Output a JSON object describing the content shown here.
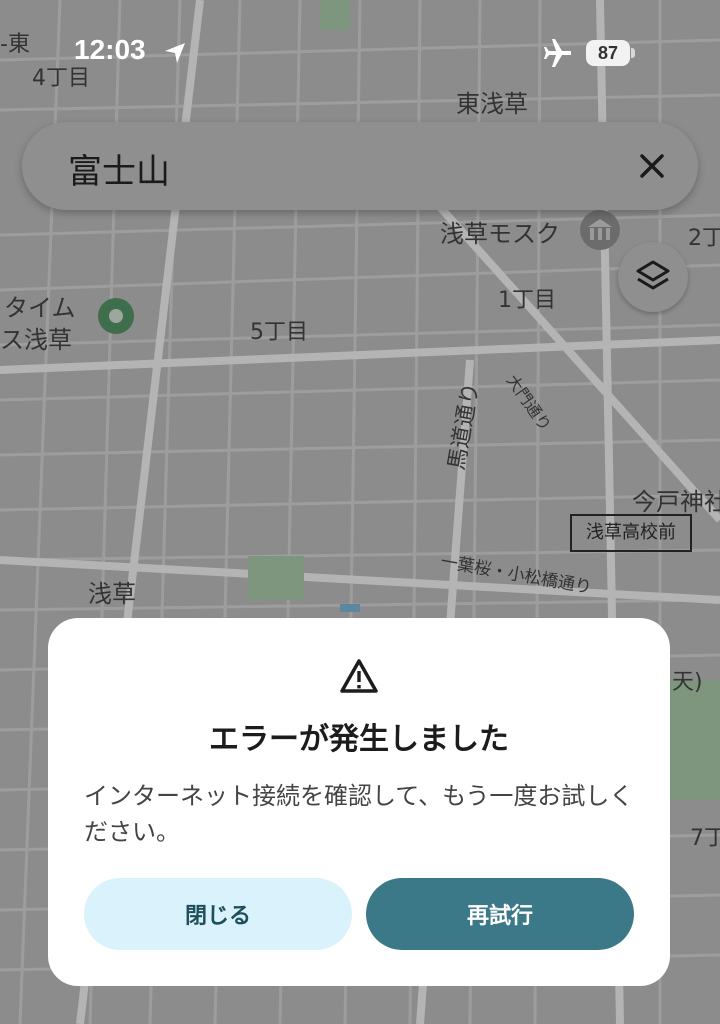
{
  "status_bar": {
    "time": "12:03",
    "battery": "87"
  },
  "search": {
    "query": "富士山"
  },
  "map": {
    "labels": [
      {
        "text": "東浅草"
      },
      {
        "text": "浅草モスク"
      },
      {
        "text": "1丁目"
      },
      {
        "text": "2丁"
      },
      {
        "text": "4丁目"
      },
      {
        "text": "5丁目"
      },
      {
        "text": "タイム"
      },
      {
        "text": "ス浅草"
      },
      {
        "text": "馬道通り"
      },
      {
        "text": "大門通り"
      },
      {
        "text": "今戸神社"
      },
      {
        "text": "浅草"
      },
      {
        "text": "一葉桜・小松橋通り"
      },
      {
        "text": "7丁"
      },
      {
        "text": "天)"
      },
      {
        "text": "-東"
      }
    ],
    "station": "浅草高校前"
  },
  "dialog": {
    "title": "エラーが発生しました",
    "message": "インターネット接続を確認して、もう一度お試しください。",
    "close_label": "閉じる",
    "retry_label": "再試行"
  },
  "colors": {
    "dialog_bg": "#ffffff",
    "close_button_bg": "#d9f2fb",
    "retry_button_bg": "#3b7989"
  }
}
